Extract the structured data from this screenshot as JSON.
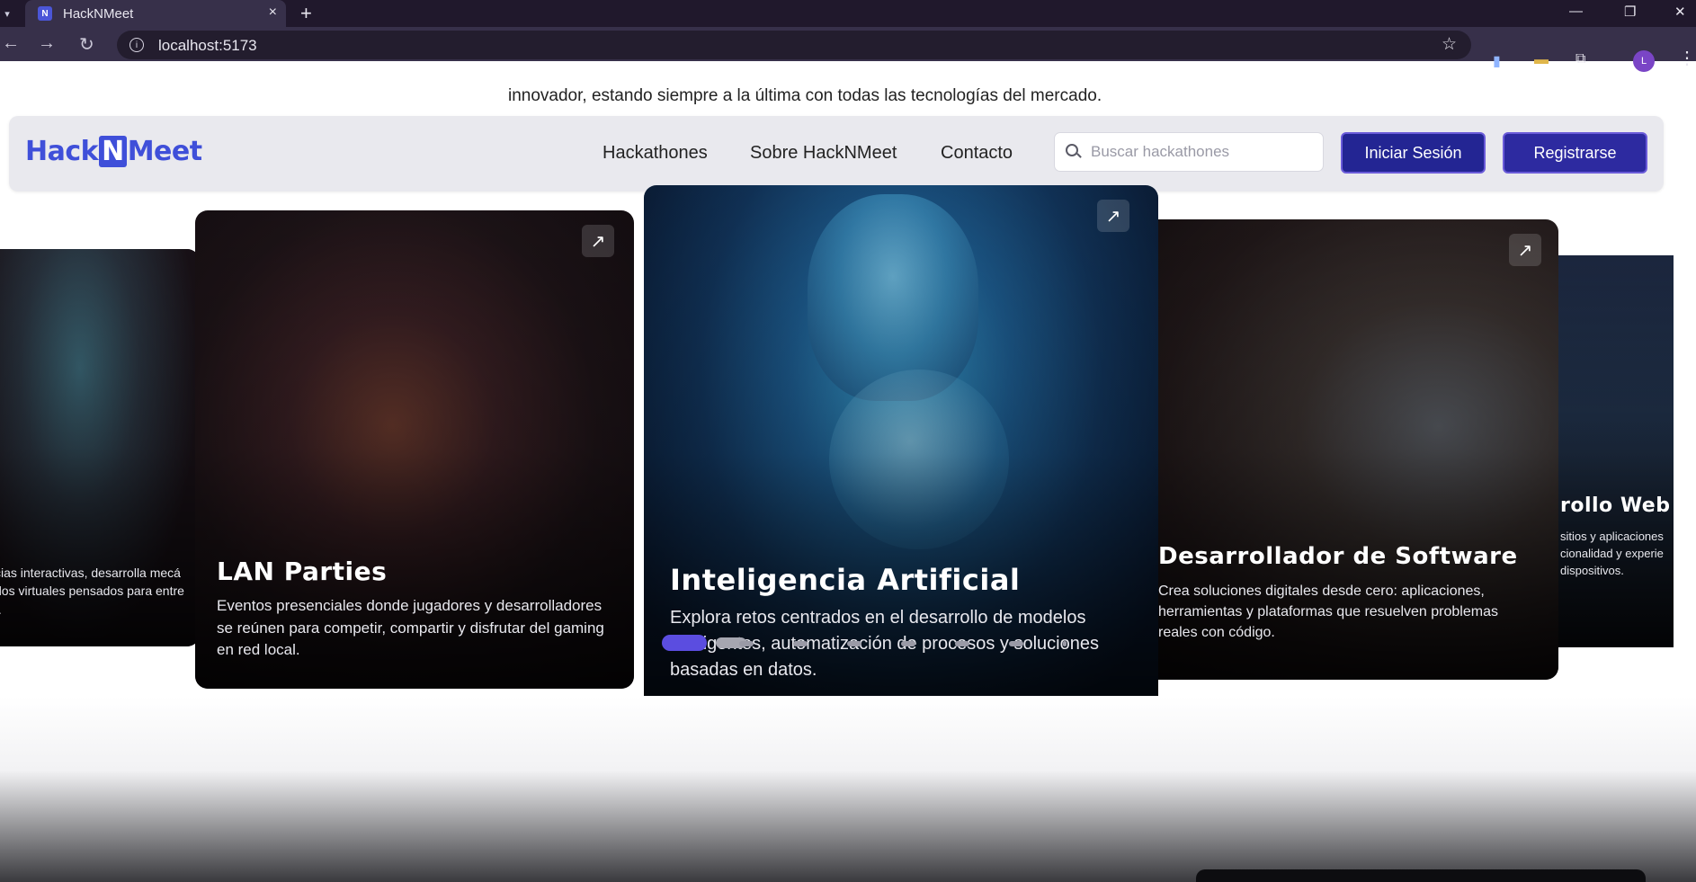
{
  "browser": {
    "tab_title": "HackNMeet",
    "tab_close": "×",
    "new_tab": "+",
    "url": "localhost:5173",
    "profile_initial": "L",
    "back": "←",
    "forward": "→",
    "reload": "↻",
    "star": "☆",
    "minimize": "—",
    "maximize": "❐",
    "close": "✕"
  },
  "page": {
    "intro_text": "innovador, estando siempre a la última con todas las tecnologías del mercado."
  },
  "navbar": {
    "logo_part1": "Hack",
    "logo_n": "N",
    "logo_part2": "Meet",
    "links": [
      "Hackathones",
      "Sobre HackNMeet",
      "Contacto"
    ],
    "search_placeholder": "Buscar hackathones",
    "login_label": "Iniciar Sesión",
    "register_label": "Registrarse"
  },
  "carousel": {
    "cards": [
      {
        "title": "",
        "description": "cias interactivas, desarrolla mecá\ndos virtuales pensados para entre\nr."
      },
      {
        "title": "LAN Parties",
        "description": "Eventos presenciales donde jugadores y desarrolladores se reúnen para competir, compartir y disfrutar del gaming en red local."
      },
      {
        "title": "Inteligencia Artificial",
        "description": "Explora retos centrados en el desarrollo de modelos inteligentes, automatización de procesos y soluciones basadas en datos."
      },
      {
        "title": "Desarrollador de Software",
        "description": "Crea soluciones digitales desde cero: aplicaciones, herramientas y plataformas que resuelven problemas reales con código."
      },
      {
        "title": "rollo Web",
        "description": "sitios y aplicaciones\ncionalidad y experie\ndispositivos."
      }
    ],
    "open_icon": "↗",
    "total_slides": 9,
    "active_slide": 1
  },
  "colors": {
    "brand": "#3f4fd9",
    "button_bg": "#232593",
    "active_dot": "#5b4de0"
  }
}
